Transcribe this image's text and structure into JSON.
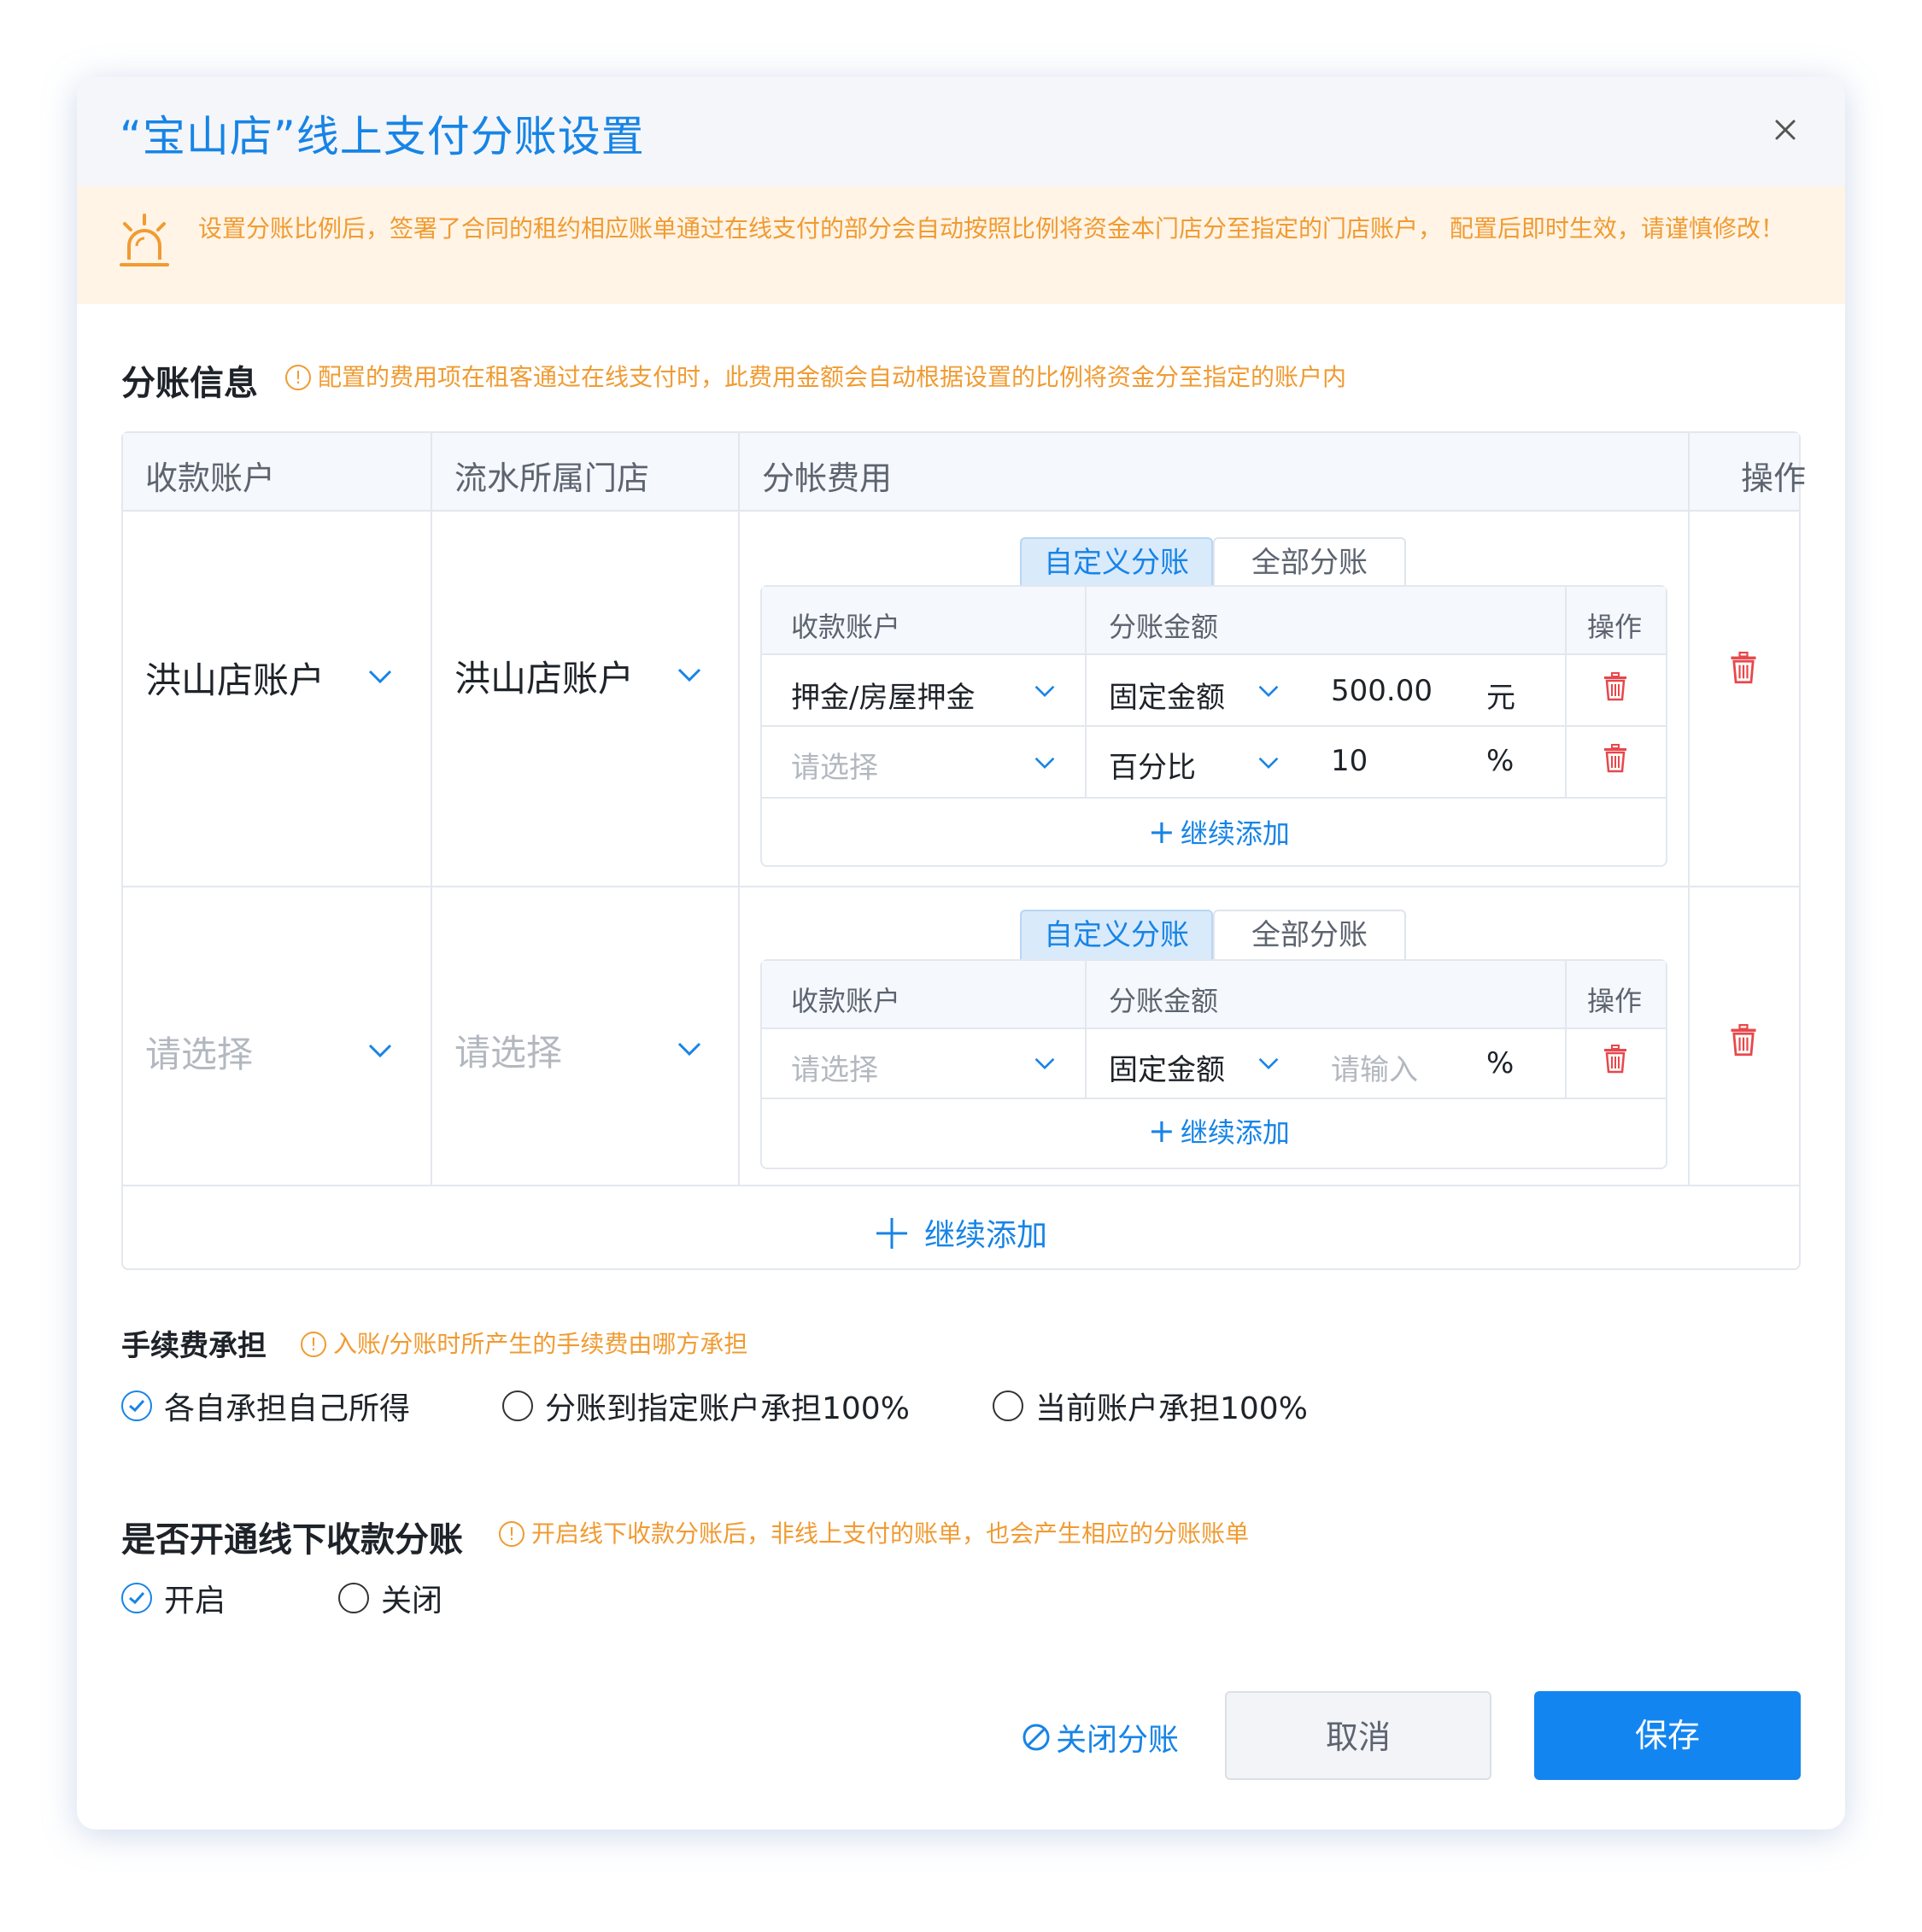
{
  "dialog": {
    "title": "“宝山店”线上支付分账设置",
    "close_icon": "close-icon",
    "warning": "设置分账比例后，签署了合同的租约相应账单通过在线支付的部分会自动按照比例将资金本门店分至指定的门店账户， 配置后即时生效，请谨慎修改！"
  },
  "split_info": {
    "title": "分账信息",
    "hint": "配置的费用项在租客通过在线支付时，此费用金额会自动根据设置的比例将资金分至指定的账户内",
    "columns": [
      "收款账户",
      "流水所属门店",
      "分帐费用",
      "操作"
    ],
    "rows": [
      {
        "account": "洪山店账户",
        "store": "洪山店账户",
        "tabs": [
          "自定义分账",
          "全部分账"
        ],
        "sub_columns": [
          "收款账户",
          "分账金额",
          "操作"
        ],
        "items": [
          {
            "account": "押金/房屋押金",
            "type": "固定金额",
            "amount": "500.00",
            "unit": "元"
          },
          {
            "account": "请选择",
            "type": "百分比",
            "amount": "10",
            "unit": "%"
          }
        ],
        "add_label": "继续添加"
      },
      {
        "account": "请选择",
        "store": "请选择",
        "tabs": [
          "自定义分账",
          "全部分账"
        ],
        "sub_columns": [
          "收款账户",
          "分账金额",
          "操作"
        ],
        "items": [
          {
            "account": "请选择",
            "type": "固定金额",
            "amount": "请输入",
            "unit": "%"
          }
        ],
        "add_label": "继续添加"
      }
    ],
    "add_row_label": "继续添加"
  },
  "fee": {
    "title": "手续费承担",
    "hint": "入账/分账时所产生的手续费由哪方承担",
    "options": [
      "各自承担自己所得",
      "分账到指定账户承担100%",
      "当前账户承担100%"
    ],
    "selected": 0
  },
  "offline": {
    "title": "是否开通线下收款分账",
    "hint": "开启线下收款分账后，非线上支付的账单，也会产生相应的分账账单",
    "options": [
      "开启",
      "关闭"
    ],
    "selected": 0
  },
  "footer": {
    "close_split": "关闭分账",
    "cancel": "取消",
    "save": "保存"
  },
  "colors": {
    "accent": "#1784e6",
    "warning": "#f09b32",
    "danger": "#e8474b",
    "save_button": "#1385f0"
  }
}
